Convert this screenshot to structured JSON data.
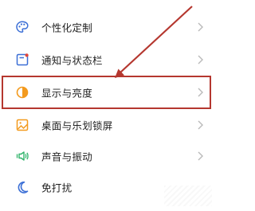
{
  "settings": {
    "items": [
      {
        "label": "个性化定制",
        "icon": "palette-icon"
      },
      {
        "label": "通知与状态栏",
        "icon": "notification-panel-icon"
      },
      {
        "label": "显示与亮度",
        "icon": "brightness-icon"
      },
      {
        "label": "桌面与乐划锁屏",
        "icon": "wallpaper-icon"
      },
      {
        "label": "声音与振动",
        "icon": "speaker-vibration-icon"
      },
      {
        "label": "免打扰",
        "icon": "moon-icon"
      }
    ]
  },
  "annotation": {
    "highlighted_item": "显示与亮度",
    "color": "#b5372f"
  },
  "colors": {
    "icon_blue": "#3b6fd6",
    "icon_red": "#e0453a",
    "icon_orange": "#f39a1e",
    "icon_green": "#2fb36a",
    "chevron": "#b9b9b9"
  }
}
